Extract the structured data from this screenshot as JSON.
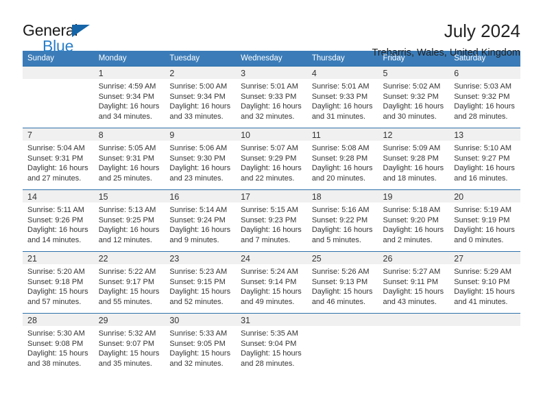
{
  "brand": {
    "name_top": "General",
    "name_bottom": "Blue",
    "accent_color": "#2a7fc9",
    "triangle_color": "#1565a8"
  },
  "header": {
    "title": "July 2024",
    "location": "Treharris, Wales, United Kingdom"
  },
  "theme": {
    "header_row_bg": "#3b7cb8",
    "row_border": "#2a6ea8",
    "daynum_bg": "#f0f0f0",
    "text": "#333333"
  },
  "weekday_headers": [
    "Sunday",
    "Monday",
    "Tuesday",
    "Wednesday",
    "Thursday",
    "Friday",
    "Saturday"
  ],
  "labels": {
    "sunrise_prefix": "Sunrise: ",
    "sunset_prefix": "Sunset: ",
    "daylight_prefix": "Daylight: "
  },
  "weeks": [
    [
      {
        "day": "",
        "empty": true,
        "sunrise": "",
        "sunset": "",
        "daylight": ""
      },
      {
        "day": "1",
        "empty": false,
        "sunrise": "Sunrise: 4:59 AM",
        "sunset": "Sunset: 9:34 PM",
        "daylight": "Daylight: 16 hours and 34 minutes."
      },
      {
        "day": "2",
        "empty": false,
        "sunrise": "Sunrise: 5:00 AM",
        "sunset": "Sunset: 9:34 PM",
        "daylight": "Daylight: 16 hours and 33 minutes."
      },
      {
        "day": "3",
        "empty": false,
        "sunrise": "Sunrise: 5:01 AM",
        "sunset": "Sunset: 9:33 PM",
        "daylight": "Daylight: 16 hours and 32 minutes."
      },
      {
        "day": "4",
        "empty": false,
        "sunrise": "Sunrise: 5:01 AM",
        "sunset": "Sunset: 9:33 PM",
        "daylight": "Daylight: 16 hours and 31 minutes."
      },
      {
        "day": "5",
        "empty": false,
        "sunrise": "Sunrise: 5:02 AM",
        "sunset": "Sunset: 9:32 PM",
        "daylight": "Daylight: 16 hours and 30 minutes."
      },
      {
        "day": "6",
        "empty": false,
        "sunrise": "Sunrise: 5:03 AM",
        "sunset": "Sunset: 9:32 PM",
        "daylight": "Daylight: 16 hours and 28 minutes."
      }
    ],
    [
      {
        "day": "7",
        "empty": false,
        "sunrise": "Sunrise: 5:04 AM",
        "sunset": "Sunset: 9:31 PM",
        "daylight": "Daylight: 16 hours and 27 minutes."
      },
      {
        "day": "8",
        "empty": false,
        "sunrise": "Sunrise: 5:05 AM",
        "sunset": "Sunset: 9:31 PM",
        "daylight": "Daylight: 16 hours and 25 minutes."
      },
      {
        "day": "9",
        "empty": false,
        "sunrise": "Sunrise: 5:06 AM",
        "sunset": "Sunset: 9:30 PM",
        "daylight": "Daylight: 16 hours and 23 minutes."
      },
      {
        "day": "10",
        "empty": false,
        "sunrise": "Sunrise: 5:07 AM",
        "sunset": "Sunset: 9:29 PM",
        "daylight": "Daylight: 16 hours and 22 minutes."
      },
      {
        "day": "11",
        "empty": false,
        "sunrise": "Sunrise: 5:08 AM",
        "sunset": "Sunset: 9:28 PM",
        "daylight": "Daylight: 16 hours and 20 minutes."
      },
      {
        "day": "12",
        "empty": false,
        "sunrise": "Sunrise: 5:09 AM",
        "sunset": "Sunset: 9:28 PM",
        "daylight": "Daylight: 16 hours and 18 minutes."
      },
      {
        "day": "13",
        "empty": false,
        "sunrise": "Sunrise: 5:10 AM",
        "sunset": "Sunset: 9:27 PM",
        "daylight": "Daylight: 16 hours and 16 minutes."
      }
    ],
    [
      {
        "day": "14",
        "empty": false,
        "sunrise": "Sunrise: 5:11 AM",
        "sunset": "Sunset: 9:26 PM",
        "daylight": "Daylight: 16 hours and 14 minutes."
      },
      {
        "day": "15",
        "empty": false,
        "sunrise": "Sunrise: 5:13 AM",
        "sunset": "Sunset: 9:25 PM",
        "daylight": "Daylight: 16 hours and 12 minutes."
      },
      {
        "day": "16",
        "empty": false,
        "sunrise": "Sunrise: 5:14 AM",
        "sunset": "Sunset: 9:24 PM",
        "daylight": "Daylight: 16 hours and 9 minutes."
      },
      {
        "day": "17",
        "empty": false,
        "sunrise": "Sunrise: 5:15 AM",
        "sunset": "Sunset: 9:23 PM",
        "daylight": "Daylight: 16 hours and 7 minutes."
      },
      {
        "day": "18",
        "empty": false,
        "sunrise": "Sunrise: 5:16 AM",
        "sunset": "Sunset: 9:22 PM",
        "daylight": "Daylight: 16 hours and 5 minutes."
      },
      {
        "day": "19",
        "empty": false,
        "sunrise": "Sunrise: 5:18 AM",
        "sunset": "Sunset: 9:20 PM",
        "daylight": "Daylight: 16 hours and 2 minutes."
      },
      {
        "day": "20",
        "empty": false,
        "sunrise": "Sunrise: 5:19 AM",
        "sunset": "Sunset: 9:19 PM",
        "daylight": "Daylight: 16 hours and 0 minutes."
      }
    ],
    [
      {
        "day": "21",
        "empty": false,
        "sunrise": "Sunrise: 5:20 AM",
        "sunset": "Sunset: 9:18 PM",
        "daylight": "Daylight: 15 hours and 57 minutes."
      },
      {
        "day": "22",
        "empty": false,
        "sunrise": "Sunrise: 5:22 AM",
        "sunset": "Sunset: 9:17 PM",
        "daylight": "Daylight: 15 hours and 55 minutes."
      },
      {
        "day": "23",
        "empty": false,
        "sunrise": "Sunrise: 5:23 AM",
        "sunset": "Sunset: 9:15 PM",
        "daylight": "Daylight: 15 hours and 52 minutes."
      },
      {
        "day": "24",
        "empty": false,
        "sunrise": "Sunrise: 5:24 AM",
        "sunset": "Sunset: 9:14 PM",
        "daylight": "Daylight: 15 hours and 49 minutes."
      },
      {
        "day": "25",
        "empty": false,
        "sunrise": "Sunrise: 5:26 AM",
        "sunset": "Sunset: 9:13 PM",
        "daylight": "Daylight: 15 hours and 46 minutes."
      },
      {
        "day": "26",
        "empty": false,
        "sunrise": "Sunrise: 5:27 AM",
        "sunset": "Sunset: 9:11 PM",
        "daylight": "Daylight: 15 hours and 43 minutes."
      },
      {
        "day": "27",
        "empty": false,
        "sunrise": "Sunrise: 5:29 AM",
        "sunset": "Sunset: 9:10 PM",
        "daylight": "Daylight: 15 hours and 41 minutes."
      }
    ],
    [
      {
        "day": "28",
        "empty": false,
        "sunrise": "Sunrise: 5:30 AM",
        "sunset": "Sunset: 9:08 PM",
        "daylight": "Daylight: 15 hours and 38 minutes."
      },
      {
        "day": "29",
        "empty": false,
        "sunrise": "Sunrise: 5:32 AM",
        "sunset": "Sunset: 9:07 PM",
        "daylight": "Daylight: 15 hours and 35 minutes."
      },
      {
        "day": "30",
        "empty": false,
        "sunrise": "Sunrise: 5:33 AM",
        "sunset": "Sunset: 9:05 PM",
        "daylight": "Daylight: 15 hours and 32 minutes."
      },
      {
        "day": "31",
        "empty": false,
        "sunrise": "Sunrise: 5:35 AM",
        "sunset": "Sunset: 9:04 PM",
        "daylight": "Daylight: 15 hours and 28 minutes."
      },
      {
        "day": "",
        "empty": true,
        "sunrise": "",
        "sunset": "",
        "daylight": ""
      },
      {
        "day": "",
        "empty": true,
        "sunrise": "",
        "sunset": "",
        "daylight": ""
      },
      {
        "day": "",
        "empty": true,
        "sunrise": "",
        "sunset": "",
        "daylight": ""
      }
    ]
  ]
}
